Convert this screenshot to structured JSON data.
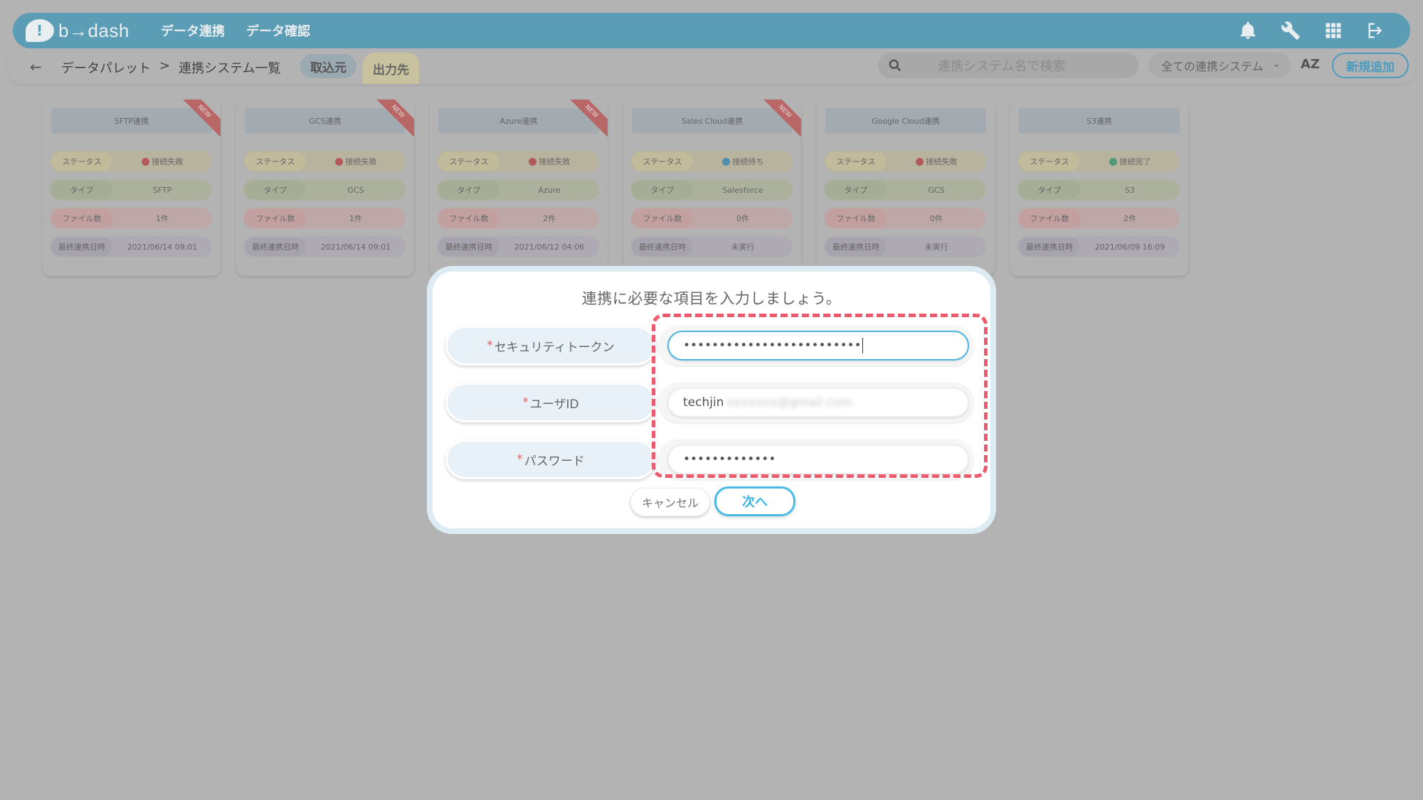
{
  "app": {
    "logo_text": "b→dash",
    "nav": [
      "データ連携",
      "データ確認"
    ]
  },
  "subbar": {
    "breadcrumb": [
      "データパレット",
      ">",
      "連携システム一覧"
    ],
    "source_tab": "取込元",
    "destination_tab": "出力先",
    "search_placeholder": "連携システム名で検索",
    "filter_value": "全ての連携システム",
    "sort_label": "AZ",
    "new_button": "新規追加"
  },
  "card_labels": {
    "status": "ステータス",
    "type": "タイプ",
    "files": "ファイル数",
    "last_sync": "最終連携日時",
    "new_badge": "NEW"
  },
  "cards": [
    {
      "title": "SFTP連携",
      "status": "接続失敗",
      "status_color": "#b55a5a",
      "type": "SFTP",
      "files": "1件",
      "last": "2021/06/14 09:01",
      "is_new": true
    },
    {
      "title": "GCS連携",
      "status": "接続失敗",
      "status_color": "#b55a5a",
      "type": "GCS",
      "files": "1件",
      "last": "2021/06/14 09:01",
      "is_new": true
    },
    {
      "title": "Azure連携",
      "status": "接続失敗",
      "status_color": "#b55a5a",
      "type": "Azure",
      "files": "2件",
      "last": "2021/06/12 04:06",
      "is_new": true
    },
    {
      "title": "Sales Cloud連携",
      "status": "接続待ち",
      "status_color": "#4f8fae",
      "type": "Salesforce",
      "files": "0件",
      "last": "未実行",
      "is_new": true
    },
    {
      "title": "Google Cloud連携",
      "status": "接続失敗",
      "status_color": "#b55a5a",
      "type": "GCS",
      "files": "0件",
      "last": "未実行",
      "is_new": false
    },
    {
      "title": "S3連携",
      "status": "接続完了",
      "status_color": "#4f9b78",
      "type": "S3",
      "files": "2件",
      "last": "2021/06/09 16:09",
      "is_new": false
    }
  ],
  "modal": {
    "title": "連携に必要な項目を入力しましょう。",
    "required_mark": "*",
    "fields": [
      {
        "label": "セキュリティトークン",
        "value": "•••••••••••••••••••••••••"
      },
      {
        "label": "ユーザID",
        "value": "techjin",
        "blurred_suffix": "xxxxxxx@gmail.com"
      },
      {
        "label": "パスワード",
        "value": "•••••••••••••"
      }
    ],
    "cancel": "キャンセル",
    "next": "次へ"
  },
  "colors": {
    "topbar": "#5c9db6",
    "accent": "#49bce6",
    "highlight_dash": "#ec5b6d"
  }
}
